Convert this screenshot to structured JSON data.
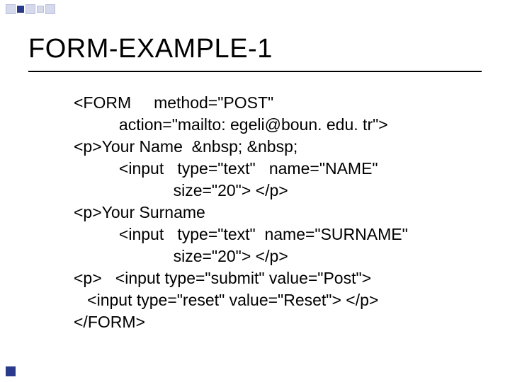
{
  "title": "FORM-EXAMPLE-1",
  "code": {
    "l1": "<FORM     method=\"POST\"",
    "l2": "          action=\"mailto: egeli@boun. edu. tr\">",
    "l3": "<p>Your Name  &nbsp; &nbsp;",
    "l4": "          <input   type=\"text\"   name=\"NAME\"",
    "l5": "                      size=\"20\"> </p>",
    "l6": "<p>Your Surname",
    "l7": "          <input   type=\"text\"  name=\"SURNAME\"",
    "l8": "                      size=\"20\"> </p>",
    "l9": "<p>   <input type=\"submit\" value=\"Post\">",
    "l10": "   <input type=\"reset\" value=\"Reset\"> </p>",
    "l11": "</FORM>"
  }
}
